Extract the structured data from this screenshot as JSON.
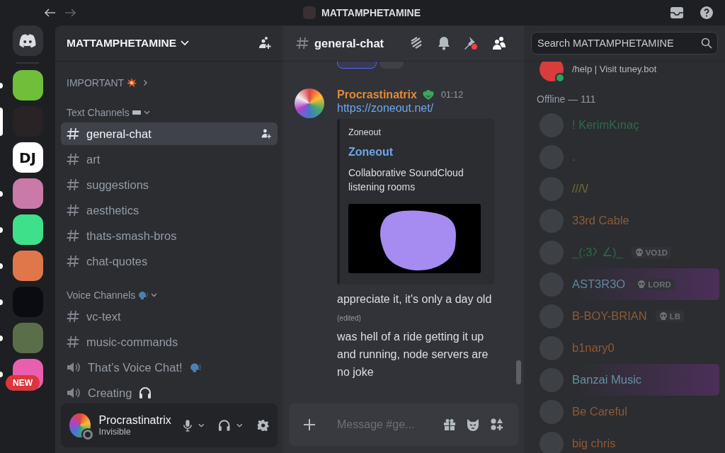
{
  "titlebar": {
    "server_name": "MATTAMPHETAMINE"
  },
  "servers": [
    {
      "kind": "home",
      "selected": false
    },
    {
      "kind": "picture",
      "color": "#6fbf3a",
      "selected": false,
      "unread": true
    },
    {
      "kind": "picture",
      "color": "#2a2326",
      "selected": true
    },
    {
      "kind": "label",
      "label": "DJ",
      "color": "#ffffff",
      "selected": false,
      "unread": false
    },
    {
      "kind": "picture",
      "color": "#c97aa8",
      "selected": false,
      "unread": true
    },
    {
      "kind": "picture",
      "color": "#3ee08a",
      "selected": false,
      "unread": true
    },
    {
      "kind": "picture",
      "color": "#e0774a",
      "selected": false,
      "unread": true
    },
    {
      "kind": "picture",
      "color": "#0b0b12",
      "selected": false,
      "unread": true
    },
    {
      "kind": "picture",
      "color": "#5a6e4a",
      "selected": false,
      "unread": true
    },
    {
      "kind": "picture",
      "color": "#e85fb0",
      "selected": false,
      "unread": true,
      "badge": "NEW"
    }
  ],
  "sidebar": {
    "server_name": "MATTAMPHETAMINE",
    "categories": [
      {
        "name": "IMPORTANT",
        "kind": "burst",
        "expanded": false
      },
      {
        "name": "Text Channels",
        "kind": "bar",
        "expanded": true,
        "channels": [
          {
            "kind": "text",
            "name": "general-chat",
            "selected": true
          },
          {
            "kind": "text",
            "name": "art",
            "selected": false
          },
          {
            "kind": "text",
            "name": "suggestions",
            "selected": false
          },
          {
            "kind": "text",
            "name": "aesthetics",
            "selected": false
          },
          {
            "kind": "text",
            "name": "thats-smash-bros",
            "selected": false
          },
          {
            "kind": "text",
            "name": "chat-quotes",
            "selected": false
          }
        ]
      },
      {
        "name": "Voice Channels",
        "kind": "speech",
        "expanded": true,
        "channels": [
          {
            "kind": "text",
            "name": "vc-text",
            "selected": false
          },
          {
            "kind": "text",
            "name": "music-commands",
            "selected": false
          },
          {
            "kind": "speaking",
            "name": "That’s Voice Chat!",
            "selected": false
          },
          {
            "kind": "headphones",
            "name": "Creating",
            "selected": false
          }
        ]
      }
    ]
  },
  "user_panel": {
    "name": "Procrastinatrix",
    "status": "Invisible"
  },
  "chat": {
    "channel": "general-chat",
    "search_placeholder": "Search MATTAMPHETAMINE",
    "message": {
      "author": "Procrastinatrix",
      "time": "01:12",
      "link": "https://zoneout.net/",
      "embed": {
        "provider": "Zoneout",
        "title": "Zoneout",
        "description": "Collaborative SoundCloud listening rooms"
      },
      "lines": [
        {
          "text": "appreciate it, it's only a day old",
          "edited": "(edited)"
        },
        {
          "text": "was hell of a ride getting it up and running, node servers are no joke"
        }
      ]
    },
    "input_placeholder": "Message #ge..."
  },
  "members": {
    "top_status": "/help | Visit tuney.bot",
    "offline_header": "Offline — 111",
    "list": [
      {
        "name": "! KerimKınaç",
        "color": "#2f6b44",
        "highlighted": false
      },
      {
        "name": ".",
        "highlighted": false
      },
      {
        "name": "///\\/",
        "color": "#7d6e34",
        "highlighted": false
      },
      {
        "name": "33rd Cable",
        "color": "#8f5a33",
        "highlighted": false
      },
      {
        "name": "_(:3",
        "name_end": "∠)_",
        "color": "#2c6a45",
        "highlighted": false,
        "tag": "VO1D"
      },
      {
        "name": "AST3R3O",
        "color": "#5b8a9c",
        "highlighted": true,
        "tag": "LORD"
      },
      {
        "name": "B-BOY-BRIAN",
        "color": "#8f5a33",
        "highlighted": false,
        "tag": "LB"
      },
      {
        "name": "b1nary0",
        "color": "#8f5a33",
        "highlighted": false
      },
      {
        "name": "Banzai Music",
        "color": "#6690a3",
        "highlighted": true
      },
      {
        "name": "Be Careful",
        "color": "#8f5a33",
        "highlighted": false
      },
      {
        "name": "big chris",
        "color": "#8f5a33",
        "highlighted": false
      }
    ]
  }
}
